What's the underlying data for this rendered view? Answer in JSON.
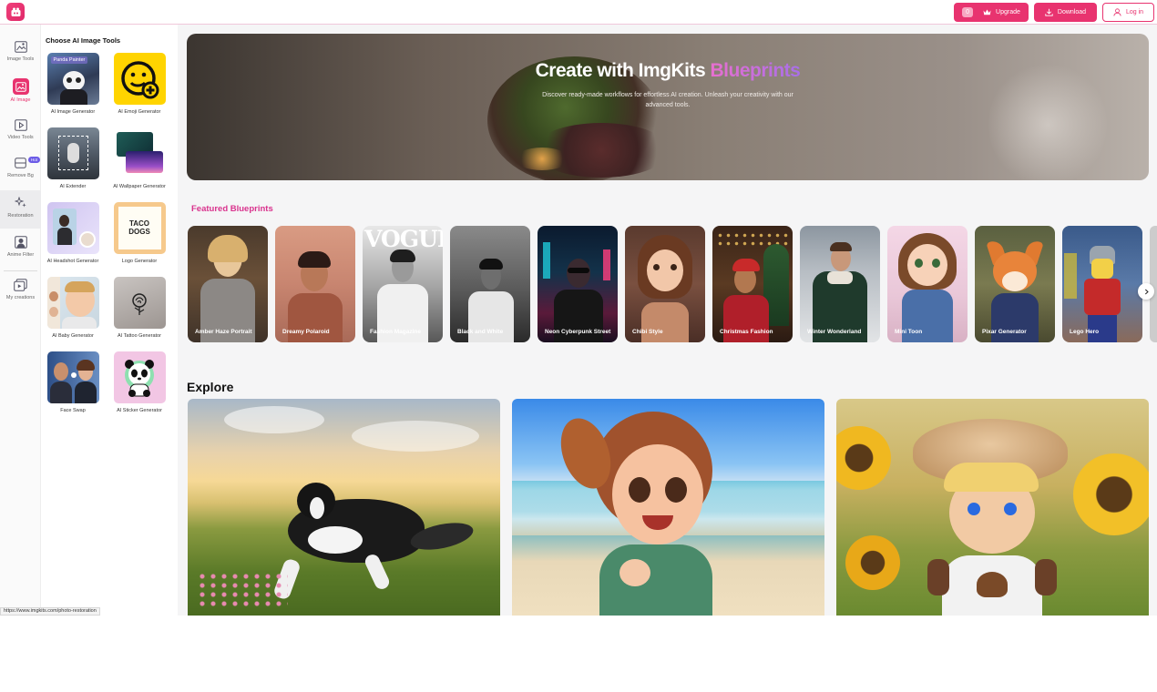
{
  "header": {
    "credits": "0",
    "upgrade_label": "Upgrade",
    "download_label": "Download",
    "login_label": "Log in"
  },
  "rail": {
    "items": [
      {
        "label": "Image Tools",
        "icon": "image-tools-icon"
      },
      {
        "label": "AI Image",
        "icon": "ai-image-icon"
      },
      {
        "label": "Video Tools",
        "icon": "video-tools-icon"
      },
      {
        "label": "Remove Bg",
        "icon": "remove-bg-icon",
        "badge": "Hot"
      },
      {
        "label": "Restoration",
        "icon": "restoration-icon"
      },
      {
        "label": "Anime Filter",
        "icon": "anime-filter-icon"
      },
      {
        "label": "My creations",
        "icon": "my-creations-icon"
      }
    ]
  },
  "tools": {
    "title": "Choose AI Image Tools",
    "items": [
      {
        "label": "AI Image Generator",
        "thumb_text": "Panda Painter"
      },
      {
        "label": "AI Emoji Generator"
      },
      {
        "label": "AI Extender"
      },
      {
        "label": "AI Wallpaper Generator"
      },
      {
        "label": "AI Headshot Generator"
      },
      {
        "label": "Logo Generator",
        "thumb_text": "TACO DOGS"
      },
      {
        "label": "AI Baby Generator"
      },
      {
        "label": "AI Tattoo Generator"
      },
      {
        "label": "Face Swap"
      },
      {
        "label": "AI Sticker Generator"
      }
    ]
  },
  "hero": {
    "title_main": "Create with ImgKits ",
    "title_accent": "Blueprints",
    "subtitle": "Discover ready-made workflows for effortless AI creation. Unleash your creativity with our advanced tools."
  },
  "featured": {
    "title": "Featured Blueprints",
    "items": [
      {
        "label": "Amber Haze Portrait"
      },
      {
        "label": "Dreamy Polaroid"
      },
      {
        "label": "Fashion Magazine",
        "overlay": "VOGUE"
      },
      {
        "label": "Black and White"
      },
      {
        "label": "Neon Cyberpunk Street"
      },
      {
        "label": "Chibi Style"
      },
      {
        "label": "Christmas Fashion"
      },
      {
        "label": "Winter Wonderland"
      },
      {
        "label": "Mini Toon"
      },
      {
        "label": "Pixar Generator"
      },
      {
        "label": "Lego Hero"
      }
    ]
  },
  "explore": {
    "title": "Explore",
    "items": [
      {
        "name": "dog-meadow"
      },
      {
        "name": "cartoon-girl-beach"
      },
      {
        "name": "boy-sunflowers"
      }
    ]
  },
  "status_url": "https://www.imgkits.com/photo-restoration",
  "colors": {
    "brand": "#e8336f",
    "accent_text": "#d9328d",
    "hot_badge": "#6c5ce7"
  }
}
